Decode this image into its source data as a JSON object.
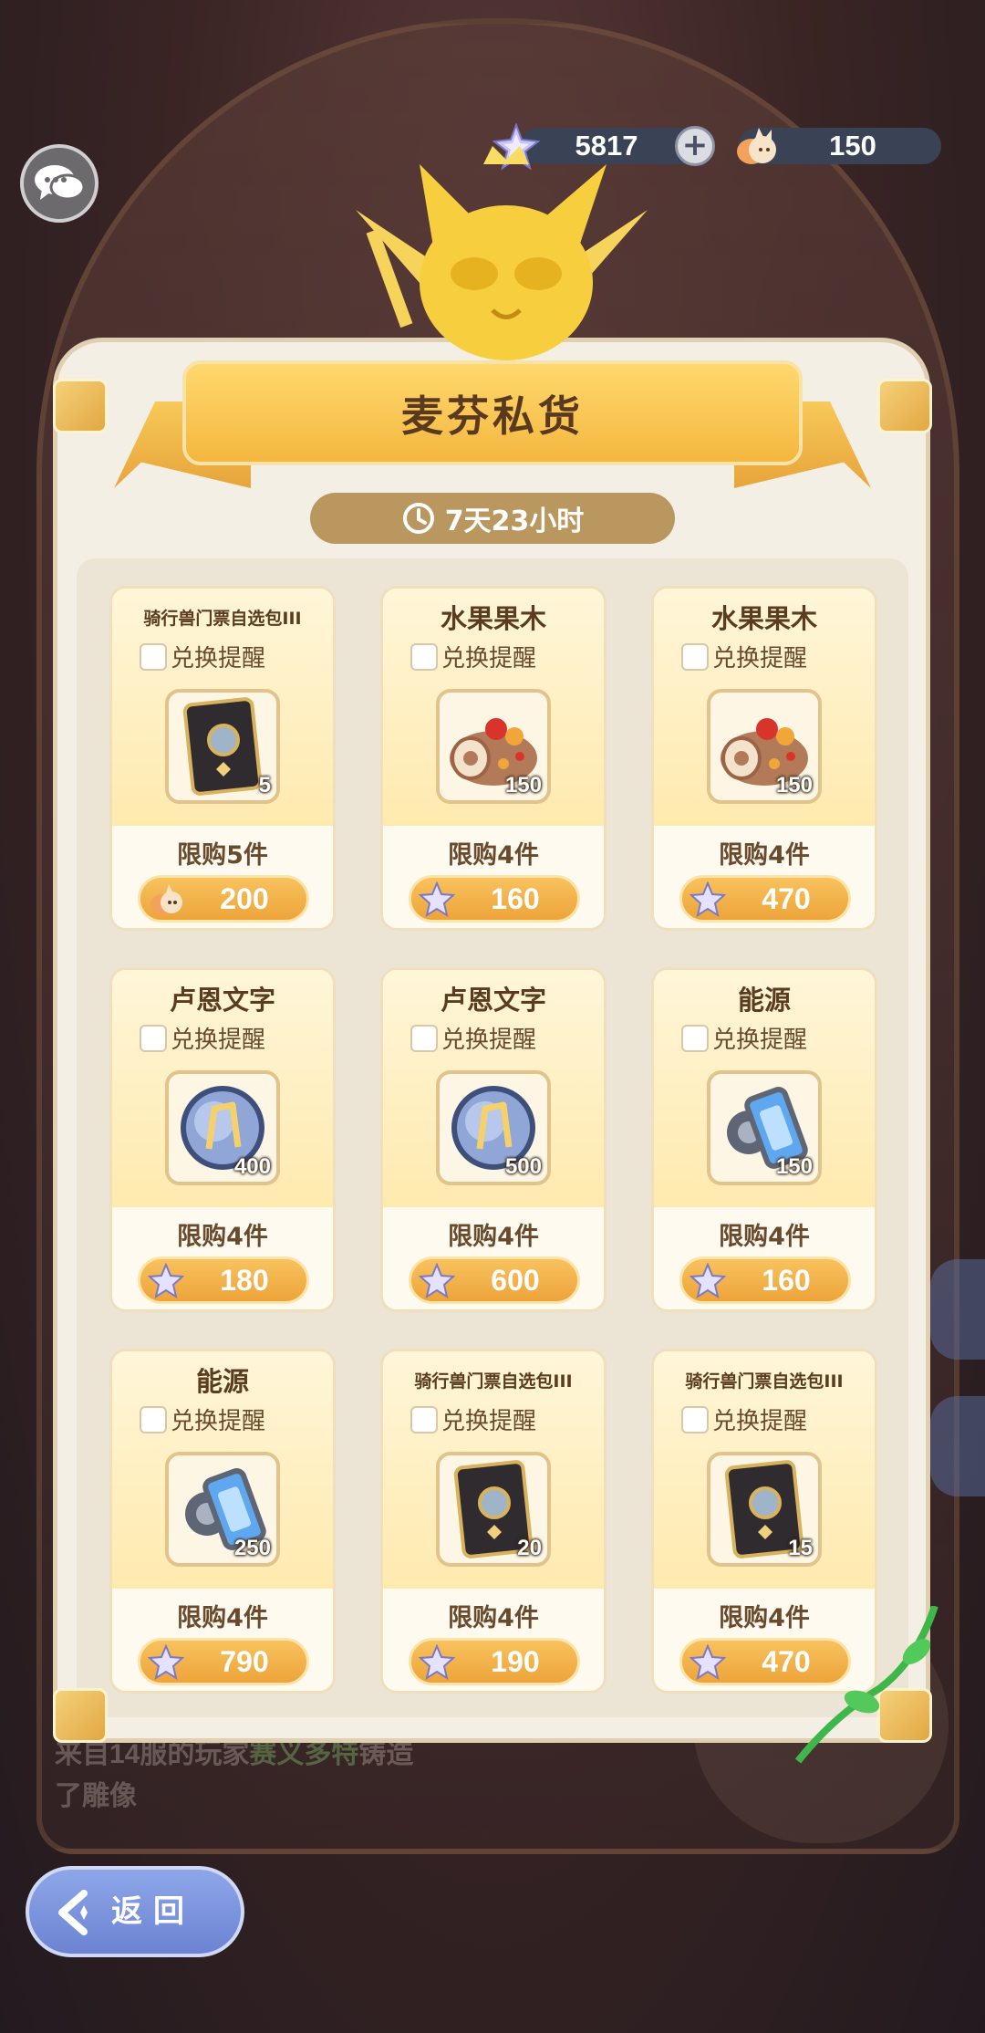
{
  "currencies": {
    "star_gems": "5817",
    "muffin_coins": "150"
  },
  "shop": {
    "title": "麦芬私货",
    "timer": "7天23小时"
  },
  "items": [
    {
      "name": "骑行兽门票自选包III",
      "small": true,
      "remind": "兑换提醒",
      "qty": "5",
      "limit": "限购5件",
      "price": "200",
      "currency": "muffin",
      "icon": "ticket-icon"
    },
    {
      "name": "水果果木",
      "small": false,
      "remind": "兑换提醒",
      "qty": "150",
      "limit": "限购4件",
      "price": "160",
      "currency": "star",
      "icon": "cake-roll-icon"
    },
    {
      "name": "水果果木",
      "small": false,
      "remind": "兑换提醒",
      "qty": "150",
      "limit": "限购4件",
      "price": "470",
      "currency": "star",
      "icon": "cake-roll-icon"
    },
    {
      "name": "卢恩文字",
      "small": false,
      "remind": "兑换提醒",
      "qty": "400",
      "limit": "限购4件",
      "price": "180",
      "currency": "star",
      "icon": "rune-orb-icon"
    },
    {
      "name": "卢恩文字",
      "small": false,
      "remind": "兑换提醒",
      "qty": "500",
      "limit": "限购4件",
      "price": "600",
      "currency": "star",
      "icon": "rune-orb-icon"
    },
    {
      "name": "能源",
      "small": false,
      "remind": "兑换提醒",
      "qty": "150",
      "limit": "限购4件",
      "price": "160",
      "currency": "star",
      "icon": "energy-cell-icon"
    },
    {
      "name": "能源",
      "small": false,
      "remind": "兑换提醒",
      "qty": "250",
      "limit": "限购4件",
      "price": "790",
      "currency": "star",
      "icon": "energy-cell-icon"
    },
    {
      "name": "骑行兽门票自选包III",
      "small": true,
      "remind": "兑换提醒",
      "qty": "20",
      "limit": "限购4件",
      "price": "190",
      "currency": "star",
      "icon": "ticket-icon"
    },
    {
      "name": "骑行兽门票自选包III",
      "small": true,
      "remind": "兑换提醒",
      "qty": "15",
      "limit": "限购4件",
      "price": "470",
      "currency": "star",
      "icon": "ticket-icon"
    }
  ],
  "background": {
    "line1_prefix": "来自14服的玩家",
    "line1_name": "赛义多特",
    "line1_suffix": "铸造",
    "line2": "了雕像"
  },
  "back_button": "返回",
  "colors": {
    "accent": "#f4b73f",
    "price_button": "#eda43a",
    "text_brown": "#5b3c20"
  }
}
